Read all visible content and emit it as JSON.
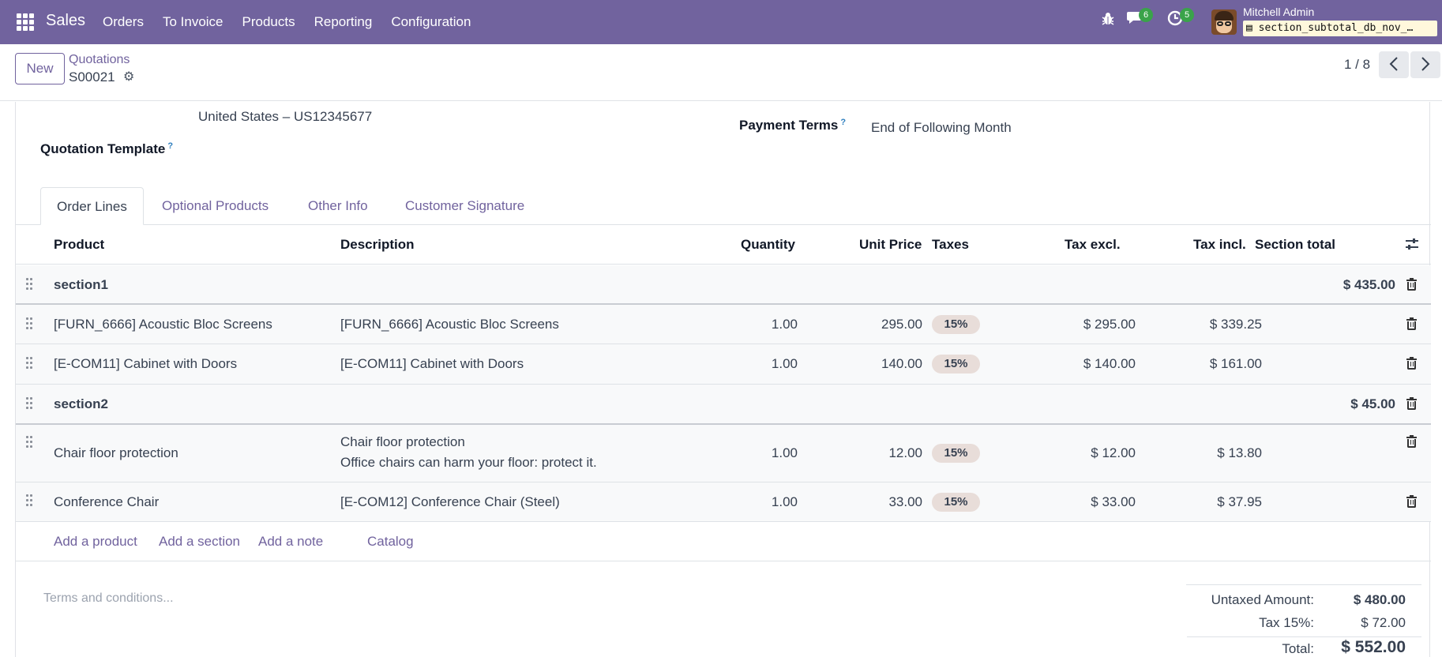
{
  "navbar": {
    "app_name": "Sales",
    "menu": [
      "Orders",
      "To Invoice",
      "Products",
      "Reporting",
      "Configuration"
    ],
    "chat_count": "6",
    "activity_count": "5",
    "user_name": "Mitchell Admin",
    "database": "section_subtotal_db_nov_…",
    "accent_color": "#71639e",
    "icons": [
      "apps-grid-icon",
      "bug-icon",
      "chat-icon",
      "clock-icon"
    ]
  },
  "control": {
    "new_label": "New",
    "breadcrumb": "Quotations",
    "record_name": "S00021",
    "pager": "1 / 8"
  },
  "form": {
    "address_line": "United States – US12345677",
    "payment_terms_label": "Payment Terms",
    "payment_terms_value": "End of Following Month",
    "quotation_template_label": "Quotation Template",
    "help_mark": "?"
  },
  "tabs": [
    "Order Lines",
    "Optional Products",
    "Other Info",
    "Customer Signature"
  ],
  "columns": {
    "product": "Product",
    "description": "Description",
    "quantity": "Quantity",
    "unit_price": "Unit Price",
    "taxes": "Taxes",
    "tax_excl": "Tax excl.",
    "tax_incl": "Tax incl.",
    "section_total": "Section total"
  },
  "lines": [
    {
      "type": "section",
      "name": "section1",
      "total": "$ 435.00"
    },
    {
      "type": "product",
      "product": "[FURN_6666] Acoustic Bloc Screens",
      "description": "[FURN_6666] Acoustic Bloc Screens",
      "description2": "",
      "quantity": "1.00",
      "unit_price": "295.00",
      "tax": "15%",
      "tax_excl": "$ 295.00",
      "tax_incl": "$ 339.25"
    },
    {
      "type": "product",
      "product": "[E-COM11] Cabinet with Doors",
      "description": "[E-COM11] Cabinet with Doors",
      "description2": "",
      "quantity": "1.00",
      "unit_price": "140.00",
      "tax": "15%",
      "tax_excl": "$ 140.00",
      "tax_incl": "$ 161.00"
    },
    {
      "type": "section",
      "name": "section2",
      "total": "$ 45.00"
    },
    {
      "type": "product",
      "product": "Chair floor protection",
      "description": "Chair floor protection",
      "description2": "Office chairs can harm your floor: protect it.",
      "quantity": "1.00",
      "unit_price": "12.00",
      "tax": "15%",
      "tax_excl": "$ 12.00",
      "tax_incl": "$ 13.80"
    },
    {
      "type": "product",
      "product": "Conference Chair",
      "description": "[E-COM12] Conference Chair (Steel)",
      "description2": "",
      "quantity": "1.00",
      "unit_price": "33.00",
      "tax": "15%",
      "tax_excl": "$ 33.00",
      "tax_incl": "$ 37.95"
    }
  ],
  "add_links": {
    "product": "Add a product",
    "section": "Add a section",
    "note": "Add a note",
    "catalog": "Catalog"
  },
  "terms_placeholder": "Terms and conditions...",
  "totals": {
    "untaxed_label": "Untaxed Amount:",
    "untaxed_value": "$ 480.00",
    "tax_label": "Tax 15%:",
    "tax_value": "$ 72.00",
    "total_label": "Total:",
    "total_value": "$ 552.00"
  }
}
